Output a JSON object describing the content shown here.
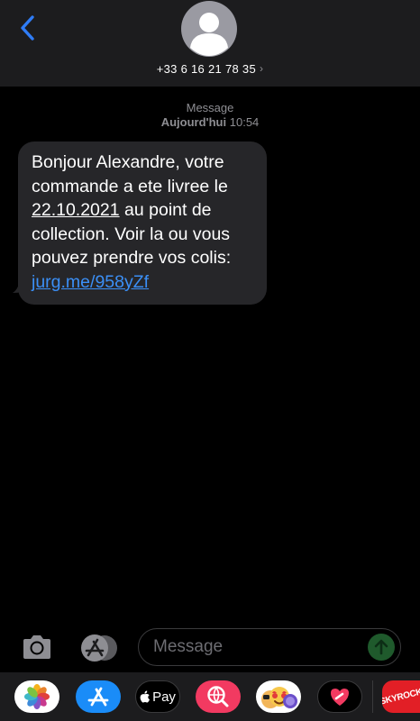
{
  "header": {
    "back_icon": "chevron-left-icon",
    "contact_number": "+33 6 16 21 78 35",
    "contact_chevron": "›"
  },
  "thread": {
    "service_label": "Message",
    "day_label": "Aujourd'hui",
    "time_label": "10:54"
  },
  "message": {
    "text_line1": "Bonjour Alexandre, votre",
    "text_line2": "commande a ete livree le",
    "date_text": "22.10.2021",
    "text_after_date": " au point de",
    "text_line4": "collection. Voir la ou vous",
    "text_line5": "pouvez prendre vos colis:",
    "link_text": "jurg.me/958yZf"
  },
  "compose": {
    "placeholder": "Message"
  },
  "apps": {
    "apple_pay_label": "Pay",
    "skyrock_label": "SKYROCK"
  },
  "colors": {
    "link": "#3b8ff6",
    "back_chevron": "#2f7cf6",
    "bubble": "#262629",
    "send": "#1f5a2c"
  }
}
